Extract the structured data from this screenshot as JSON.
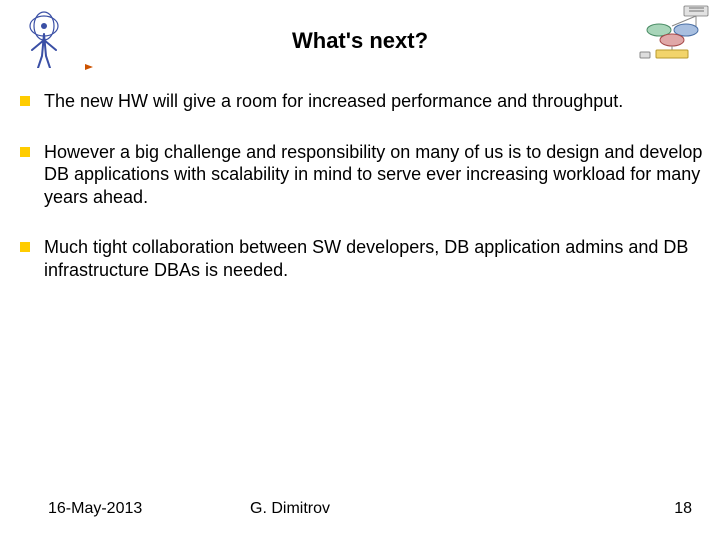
{
  "header": {
    "title": "What's next?"
  },
  "bullets": [
    "The new HW will give a room for increased performance and throughput.",
    "However a big challenge and responsibility on many of us is to design and develop DB applications with scalability in mind to serve ever increasing workload for many years ahead.",
    "Much tight collaboration between SW developers, DB application admins and DB infrastructure DBAs is needed."
  ],
  "footer": {
    "date": "16-May-2013",
    "author": "G. Dimitrov",
    "page": "18"
  },
  "colors": {
    "bullet": "#ffcc00",
    "underline_start": "#ff6600",
    "underline_end": "#ffd966"
  }
}
